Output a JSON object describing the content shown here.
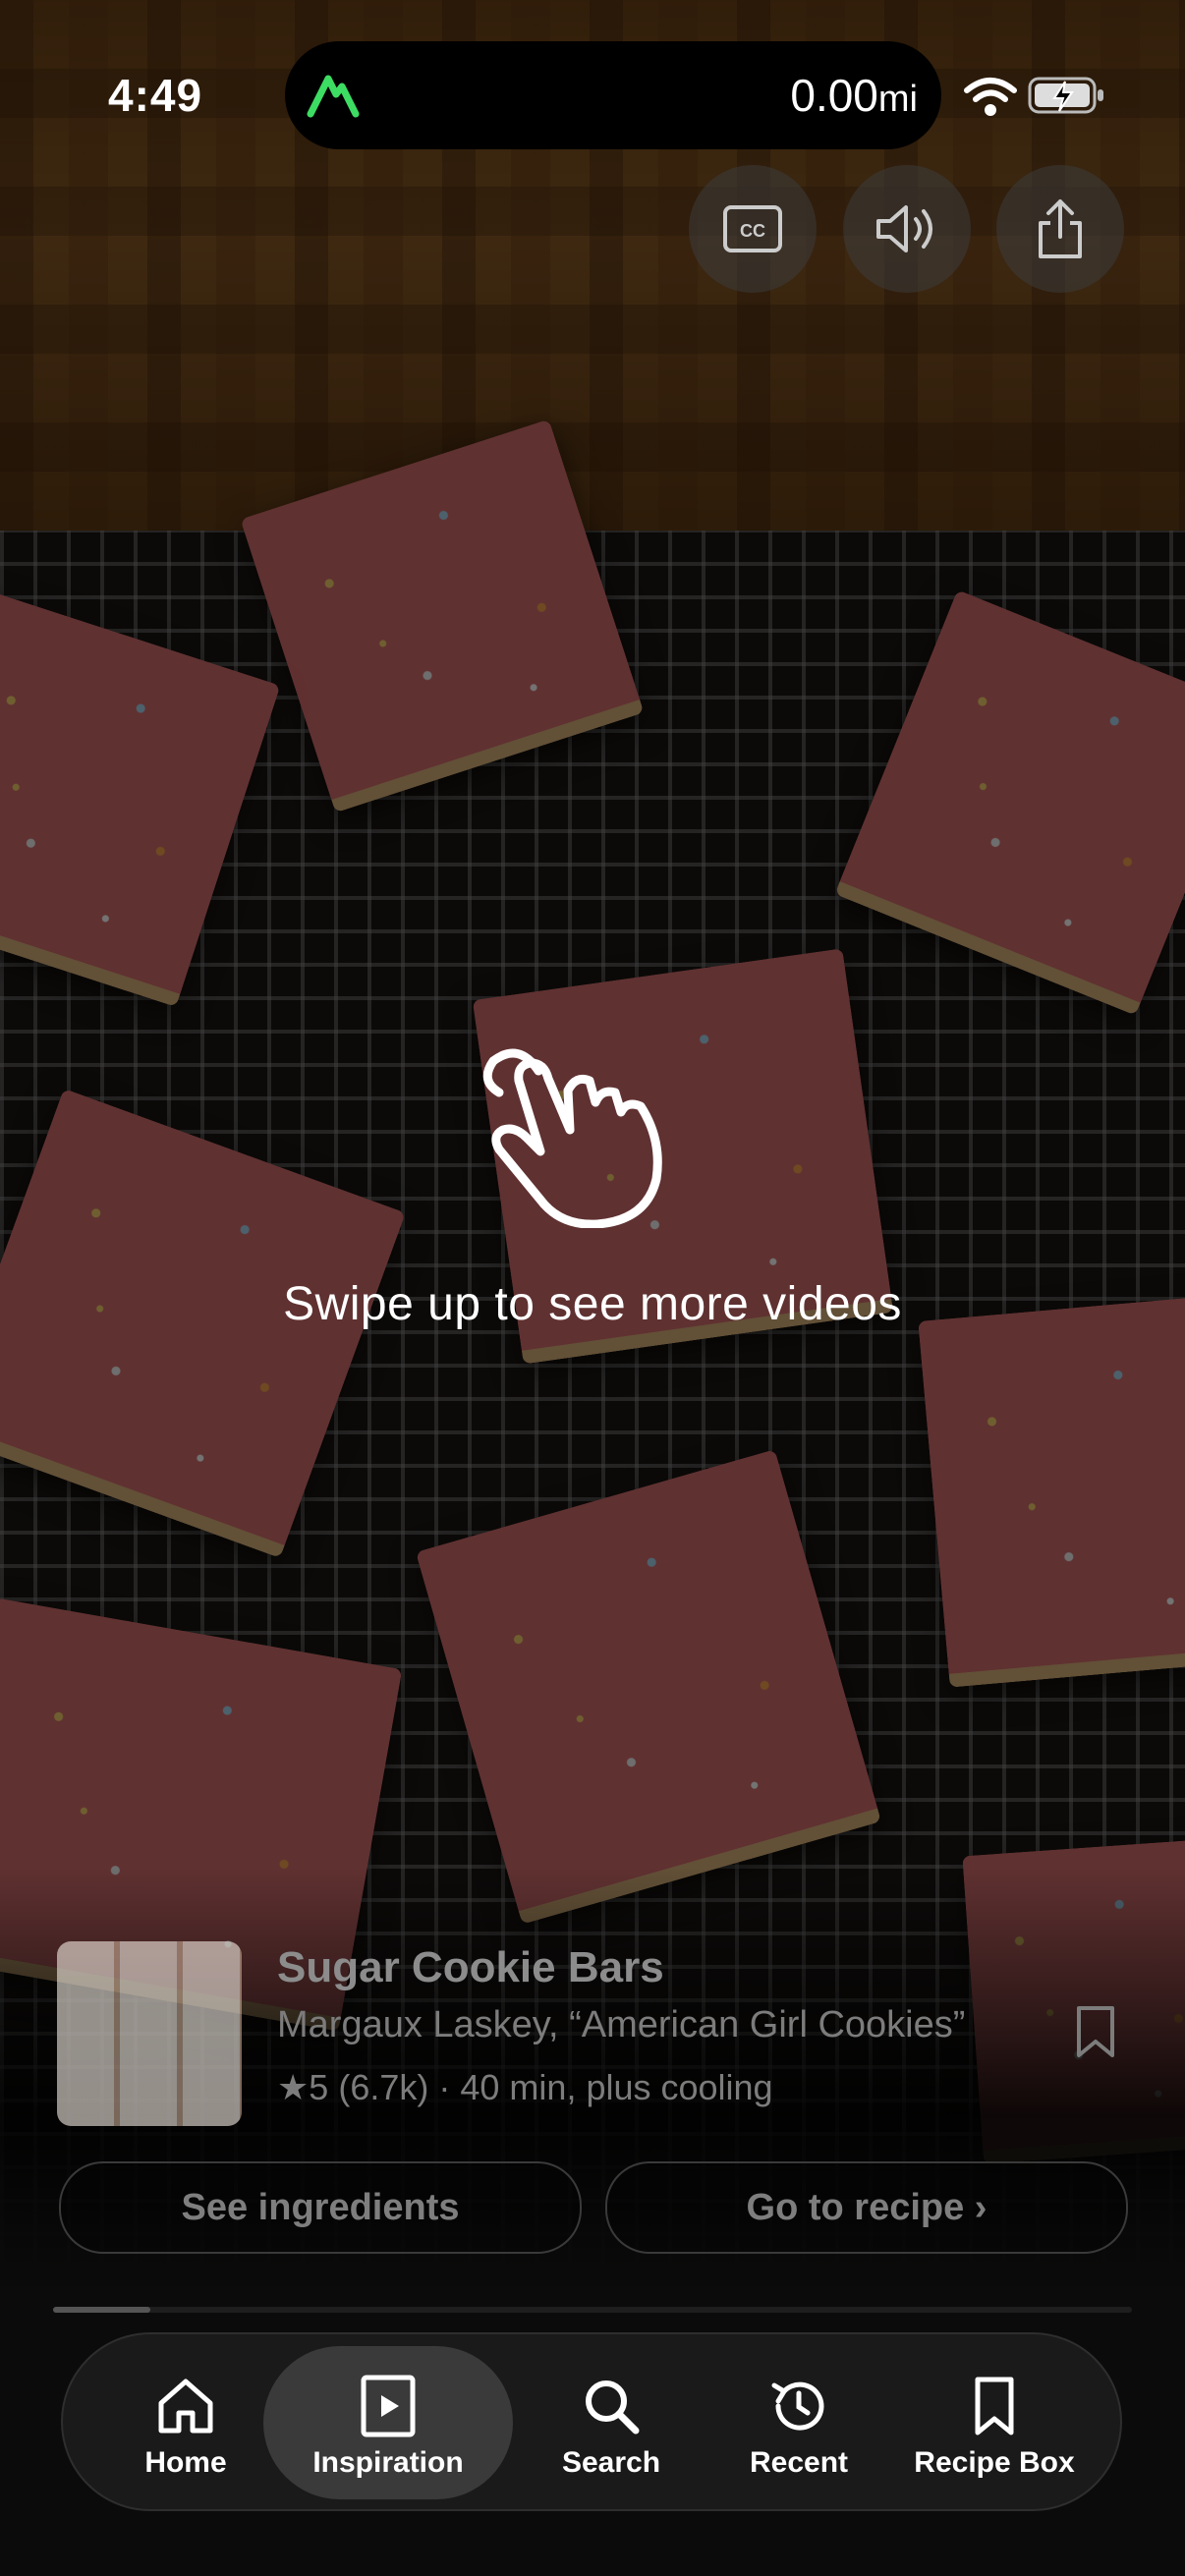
{
  "status_bar": {
    "time": "4:49",
    "distance_value": "0.00",
    "distance_unit": "mi"
  },
  "top_controls": [
    "closed-captions-icon",
    "speaker-icon",
    "share-icon"
  ],
  "overlay": {
    "hint_text": "Swipe up to see more videos",
    "icon": "tap-hand-icon"
  },
  "recipe": {
    "title": "Sugar Cookie Bars",
    "author": "Margaux Laskey, “American Girl Cookies”",
    "rating_star": "★",
    "rating": "5",
    "rating_count": "(6.7k)",
    "separator": "·",
    "time": "40 min, plus cooling"
  },
  "actions": {
    "ingredients_label": "See ingredients",
    "recipe_label": "Go to recipe ›"
  },
  "progress": 0.09,
  "tabs": [
    {
      "label": "Home",
      "icon": "home-icon"
    },
    {
      "label": "Inspiration",
      "icon": "play-square-icon"
    },
    {
      "label": "Search",
      "icon": "search-icon"
    },
    {
      "label": "Recent",
      "icon": "history-icon"
    },
    {
      "label": "Recipe Box",
      "icon": "bookmark-icon"
    }
  ],
  "active_tab": "Inspiration",
  "colors": {
    "app_logo_green": "#3ddc63",
    "frosting_pink": "#d66d6d",
    "tab_active_bg": "#3a3a3a"
  }
}
